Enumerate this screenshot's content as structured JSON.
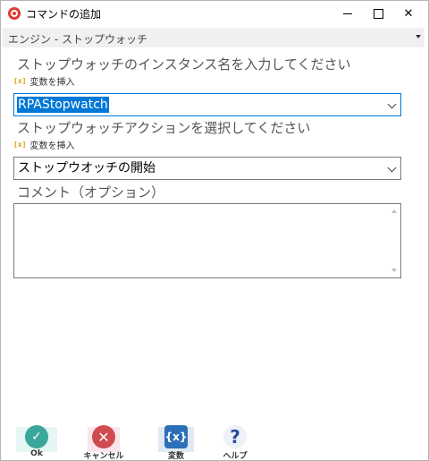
{
  "window": {
    "title": "コマンドの追加",
    "minimize_icon": "minimize-icon",
    "maximize_icon": "maximize-icon",
    "close_icon": "close-icon",
    "close_glyph": "✕"
  },
  "header": {
    "title": "エンジン - ストップウォッチ"
  },
  "form": {
    "instance": {
      "label": "ストップウォッチのインスタンス名を入力してください",
      "insert_variable": "変数を挿入",
      "value": "RPAStopwatch"
    },
    "action": {
      "label": "ストップウォッチアクションを選択してください",
      "insert_variable": "変数を挿入",
      "value": "ストップウオッチの開始"
    },
    "comment": {
      "label": "コメント（オプション）",
      "value": ""
    }
  },
  "footer": {
    "ok_label": "Ok",
    "ok_glyph": "✓",
    "cancel_label": "キャンセル",
    "cancel_glyph": "✕",
    "variable_label": "変数",
    "variable_glyph": "{x}",
    "help_label": "ヘルプ",
    "help_glyph": "?"
  },
  "colors": {
    "selection": "#0078d7",
    "ok": "#3aa79a",
    "cancel": "#cf4b50",
    "variable": "#2d6fb8",
    "help": "#2b4a9b",
    "variable_icon": "#d8a000"
  }
}
